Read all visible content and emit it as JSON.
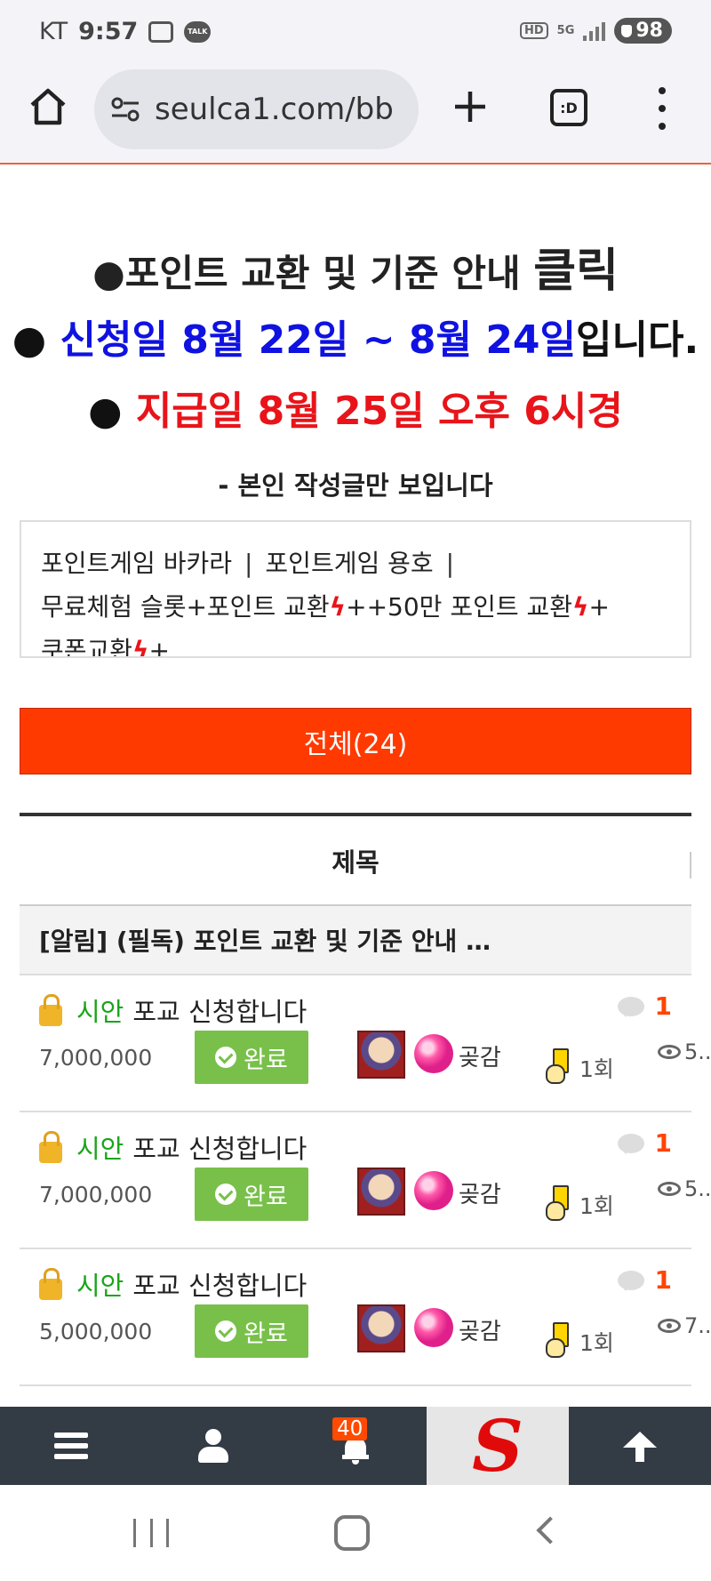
{
  "status_bar": {
    "carrier": "KT",
    "time": "9:57",
    "talk_label": "TALK",
    "hd_label": "HD",
    "network_label": "5G",
    "battery": "98"
  },
  "browser": {
    "url": "seulca1.com/bb",
    "tabs_label": ":D"
  },
  "notice": {
    "line1_text": "●포인트 교환 및 기준 안내 ",
    "line1_click": "클릭",
    "line2_bullet": "● ",
    "line2_highlight": "신청일 8월 22일 ~ 8월 24일",
    "line2_suffix": "입니다.",
    "line3_bullet": "● ",
    "line3_highlight": "지급일 8월 25일 오후 6시경",
    "subtext": "- 본인 작성글만 보입니다"
  },
  "categories": {
    "item1": "포인트게임 바카라",
    "item2": "포인트게임 용호",
    "separator": "|",
    "item3": "무료체험 슬롯+포인트 교환",
    "item4": "+50만 포인트 교환",
    "item5": "쿠폰교환",
    "plus": "+",
    "bolt": "ϟ"
  },
  "all_button": "전체(24)",
  "table": {
    "header_title": "제목",
    "notice_row": "[알림] (필독) 포인트 교환 및 기준 안내 …"
  },
  "posts": [
    {
      "category": "시안",
      "title": "포교 신청합니다",
      "comments": "1",
      "amount": "7,000,000",
      "status": "완료",
      "nickname": "곶감",
      "times": "1회",
      "views": "5.."
    },
    {
      "category": "시안",
      "title": "포교 신청합니다",
      "comments": "1",
      "amount": "7,000,000",
      "status": "완료",
      "nickname": "곶감",
      "times": "1회",
      "views": "5.."
    },
    {
      "category": "시안",
      "title": "포교 신청합니다",
      "comments": "1",
      "amount": "5,000,000",
      "status": "완료",
      "nickname": "곶감",
      "times": "1회",
      "views": "7.."
    }
  ],
  "app_bar": {
    "notification_badge": "40",
    "logo_letter": "S"
  },
  "colors": {
    "accent": "#ff3a00",
    "blue_highlight": "#0f12e0",
    "red_highlight": "#e8141a",
    "status_done": "#78c04a",
    "category_green": "#1aa51a",
    "appbar_bg": "#333b45"
  }
}
